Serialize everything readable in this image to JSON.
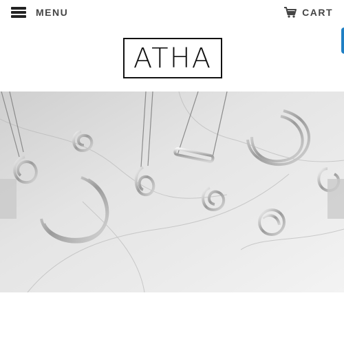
{
  "header": {
    "menu_label": "MENU",
    "cart_label": "CART",
    "accent_color": "#1f7fc4"
  },
  "brand": {
    "logo_text": "ATHA"
  },
  "hero": {
    "image": "silver-jewelry-on-marble"
  },
  "icons": [
    "hamburger-icon",
    "cart-icon",
    "chevron-left-icon",
    "chevron-right-icon"
  ]
}
